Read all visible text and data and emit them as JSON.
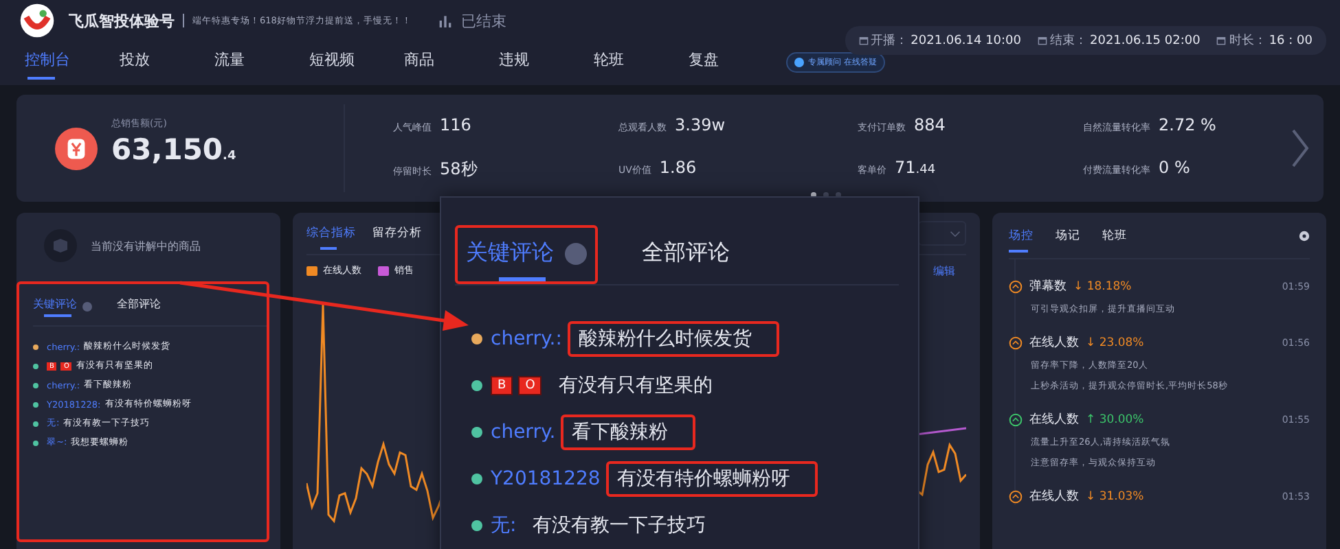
{
  "header": {
    "title": "飞瓜智投体验号",
    "slogan": "端午特惠专场！618好物节浮力提前送，手慢无！！",
    "status": "已结束",
    "tabs": [
      {
        "label": "控制台",
        "selected": true
      },
      {
        "label": "投放",
        "selected": false
      },
      {
        "label": "流量",
        "selected": false
      },
      {
        "label": "短视频",
        "selected": false
      },
      {
        "label": "商品",
        "selected": false
      },
      {
        "label": "违规",
        "selected": false
      },
      {
        "label": "轮班",
        "selected": false
      },
      {
        "label": "复盘",
        "selected": false
      }
    ],
    "advisor_badge": "专属顾问 在线答疑",
    "times": [
      {
        "label": "开播：",
        "value": "2021.06.14 10:00"
      },
      {
        "label": "结束：",
        "value": "2021.06.15 02:00"
      },
      {
        "label": "时长：",
        "value": "16 : 00"
      }
    ]
  },
  "stats": {
    "total_label": "总销售额(元)",
    "total_value": "63,150",
    "total_small": ".4",
    "metrics": [
      {
        "label": "人气峰值",
        "value": "116"
      },
      {
        "label": "停留时长",
        "value": "58秒"
      },
      {
        "label": "总观看人数",
        "value": "3.39w"
      },
      {
        "label": "UV价值",
        "value": "1.86"
      },
      {
        "label": "支付订单数",
        "value": "884"
      },
      {
        "label": "客单价",
        "value": "71",
        "small": ".44"
      },
      {
        "label": "自然流量转化率",
        "value": "2.72 %"
      },
      {
        "label": "付费流量转化率",
        "value": "0 %"
      }
    ],
    "pages": [
      {
        "selected": true
      },
      {
        "selected": false
      },
      {
        "selected": false
      }
    ]
  },
  "product_panel": {
    "empty_text": "当前没有讲解中的商品",
    "tabs": [
      {
        "label": "关键评论",
        "selected": true
      },
      {
        "label": "全部评论",
        "selected": false
      }
    ],
    "comments": [
      {
        "kind": "name",
        "user": "cherry.:",
        "text": "酸辣粉什么时候发货",
        "color": "#e8a95c"
      },
      {
        "kind": "badges",
        "badges": [
          "B",
          "O"
        ],
        "text": "有没有只有坚果的",
        "color": "#4fc3a1"
      },
      {
        "kind": "name",
        "user": "cherry.:",
        "text": "看下酸辣粉",
        "color": "#4fc3a1"
      },
      {
        "kind": "name",
        "user": "Y20181228:",
        "text": "有没有特价螺蛳粉呀",
        "color": "#4fc3a1"
      },
      {
        "kind": "name",
        "user": "无:",
        "text": "有没有教一下子技巧",
        "color": "#4fc3a1"
      },
      {
        "kind": "name",
        "user": "翠~:",
        "text": "我想要螺蛳粉",
        "color": "#4fc3a1"
      }
    ]
  },
  "chart_panel": {
    "tabs": [
      {
        "label": "综合指标",
        "selected": true
      },
      {
        "label": "留存分析",
        "selected": false
      }
    ],
    "legend": [
      {
        "label": "在线人数",
        "color": "#f08a24"
      },
      {
        "label": "销售",
        "color": "#c85ad8"
      }
    ],
    "edit_link": "编辑"
  },
  "zoom_popup": {
    "tabs": [
      {
        "label": "关键评论",
        "selected": true
      },
      {
        "label": "全部评论",
        "selected": false
      }
    ],
    "comments": [
      {
        "kind": "name",
        "user": "cherry.:",
        "text": "酸辣粉什么时候发货",
        "color": "#e8a95c",
        "highlighted": true
      },
      {
        "kind": "badges",
        "badges": [
          "B",
          "O"
        ],
        "text": "有没有只有坚果的",
        "color": "#4fc3a1",
        "highlighted": false
      },
      {
        "kind": "name",
        "user": "cherry.",
        "text": "看下酸辣粉",
        "color": "#4fc3a1",
        "highlighted": true
      },
      {
        "kind": "name",
        "user": "Y20181228",
        "text": "有没有特价螺蛳粉呀",
        "color": "#4fc3a1",
        "highlighted": true
      },
      {
        "kind": "name",
        "user": "无:",
        "text": "有没有教一下子技巧",
        "color": "#4fc3a1",
        "highlighted": false
      }
    ]
  },
  "control_panel": {
    "tabs": [
      {
        "label": "场控",
        "selected": true
      },
      {
        "label": "场记",
        "selected": false
      },
      {
        "label": "轮班",
        "selected": false
      }
    ],
    "events": [
      {
        "title": "弹幕数",
        "kind": "down",
        "change": "↓ 18.18%",
        "time": "01:59",
        "notes": [
          "可引导观众扣屏，提升直播间互动"
        ]
      },
      {
        "title": "在线人数",
        "kind": "down",
        "change": "↓ 23.08%",
        "time": "01:56",
        "notes": [
          "留存率下降，人数降至20人",
          "上秒杀活动，提升观众停留时长,平均时长58秒"
        ]
      },
      {
        "title": "在线人数",
        "kind": "up",
        "change": "↑ 30.00%",
        "time": "01:55",
        "notes": [
          "流量上升至26人,请持续活跃气氛",
          "注意留存率，与观众保持互动"
        ]
      },
      {
        "title": "在线人数",
        "kind": "down",
        "change": "↓ 31.03%",
        "time": "01:53"
      }
    ]
  }
}
